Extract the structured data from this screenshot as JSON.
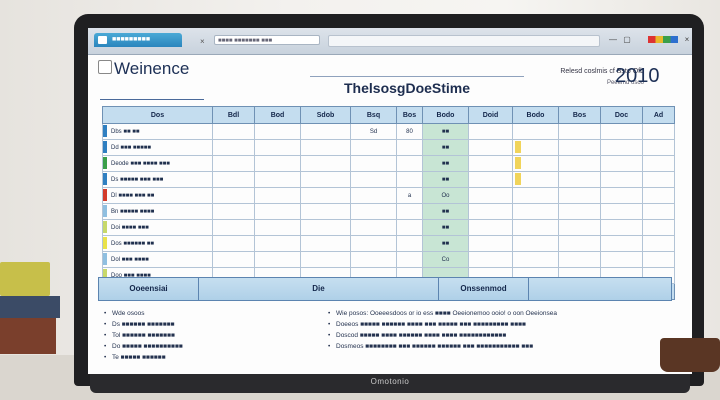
{
  "browser": {
    "tab_label": "■■■■■■■■■",
    "tab_close": "×",
    "address": "■■■■ ■■■■■■■ ■■■",
    "buttons": [
      "—",
      "▢",
      "×"
    ]
  },
  "app": {
    "logo_text": "Weinence",
    "page_title": "ThelsosgDoeStime",
    "meta_text": "Relesd coslmis cf Bsto Ofb",
    "meta_sub": "Peeemd osoo",
    "year": "2010"
  },
  "table": {
    "headers": [
      "Dos",
      "Bdl",
      "Bod",
      "Sdob",
      "Bsq",
      "Bos",
      "Bodo",
      "Doid",
      "Bodo",
      "Bos",
      "Doc",
      "Ad"
    ],
    "rows": [
      {
        "label": "Dbs ■■ ■■",
        "color": "#2f7fc1",
        "c1": "",
        "c2": "",
        "c3": "",
        "c4": "Sd",
        "c5": "80",
        "green": "■■",
        "yellow": false
      },
      {
        "label": "Dd ■■■ ■■■■■",
        "color": "#2f7fc1",
        "c1": "",
        "c2": "",
        "c3": "",
        "c4": "",
        "c5": "",
        "green": "■■",
        "yellow": true
      },
      {
        "label": "Deode ■■■ ■■■■ ■■■",
        "color": "#3a9f4a",
        "c1": "",
        "c2": "",
        "c3": "",
        "c4": "",
        "c5": "",
        "green": "■■",
        "yellow": true
      },
      {
        "label": "Ds ■■■■■ ■■■ ■■■",
        "color": "#2f7fc1",
        "c1": "",
        "c2": "",
        "c3": "",
        "c4": "",
        "c5": "",
        "green": "■■",
        "yellow": true
      },
      {
        "label": "Dl ■■■■ ■■■ ■■",
        "color": "#d33b2c",
        "c1": "",
        "c2": "",
        "c3": "",
        "c4": "",
        "c5": "a",
        "green": "Oo",
        "yellow": false
      },
      {
        "label": "Bn ■■■■■ ■■■■",
        "color": "#8fbfe0",
        "c1": "",
        "c2": "",
        "c3": "",
        "c4": "",
        "c5": "",
        "green": "■■",
        "yellow": false
      },
      {
        "label": "Doi ■■■■ ■■■",
        "color": "#c7d86a",
        "c1": "",
        "c2": "",
        "c3": "",
        "c4": "",
        "c5": "",
        "green": "■■",
        "yellow": false
      },
      {
        "label": "Dos ■■■■■■ ■■",
        "color": "#e9e24a",
        "c1": "",
        "c2": "",
        "c3": "",
        "c4": "",
        "c5": "",
        "green": "■■",
        "yellow": false
      },
      {
        "label": "Dol ■■■ ■■■■",
        "color": "#8fbfe0",
        "c1": "",
        "c2": "",
        "c3": "",
        "c4": "",
        "c5": "",
        "green": "Co",
        "yellow": false
      },
      {
        "label": "Doo ■■■ ■■■■",
        "color": "#c7d86a",
        "c1": "",
        "c2": "",
        "c3": "",
        "c4": "",
        "c5": "",
        "green": "",
        "yellow": false
      }
    ]
  },
  "summary": {
    "left": "Ooeensiai",
    "mid": "Die",
    "right": "Onssenmod"
  },
  "notes": {
    "left": [
      "Wde osoos",
      "Ds ■■■■■■ ■■■■■■■",
      "Tol ■■■■■■ ■■■■■■■",
      "Do ■■■■■ ■■■■■■■■■■",
      "Te ■■■■■ ■■■■■■"
    ],
    "right": [
      "Wie posos: Ooeeesdoos or io ess ■■■■ Oeeionemoo ooio! o oon Oeeionsea",
      "Doeeos ■■■■■ ■■■■■■ ■■■■ ■■■ ■■■■■ ■■■ ■■■■■■■■■ ■■■■",
      "Doscod ■■■■■ ■■■■ ■■■■■■ ■■■■ ■■■■ ■■■■■■■■■■■■",
      "Dosmeos ■■■■■■■■ ■■■ ■■■■■■ ■■■■■■ ■■■ ■■■■■■■■■■■ ■■■"
    ]
  },
  "laptop_brand": "Omotonio"
}
